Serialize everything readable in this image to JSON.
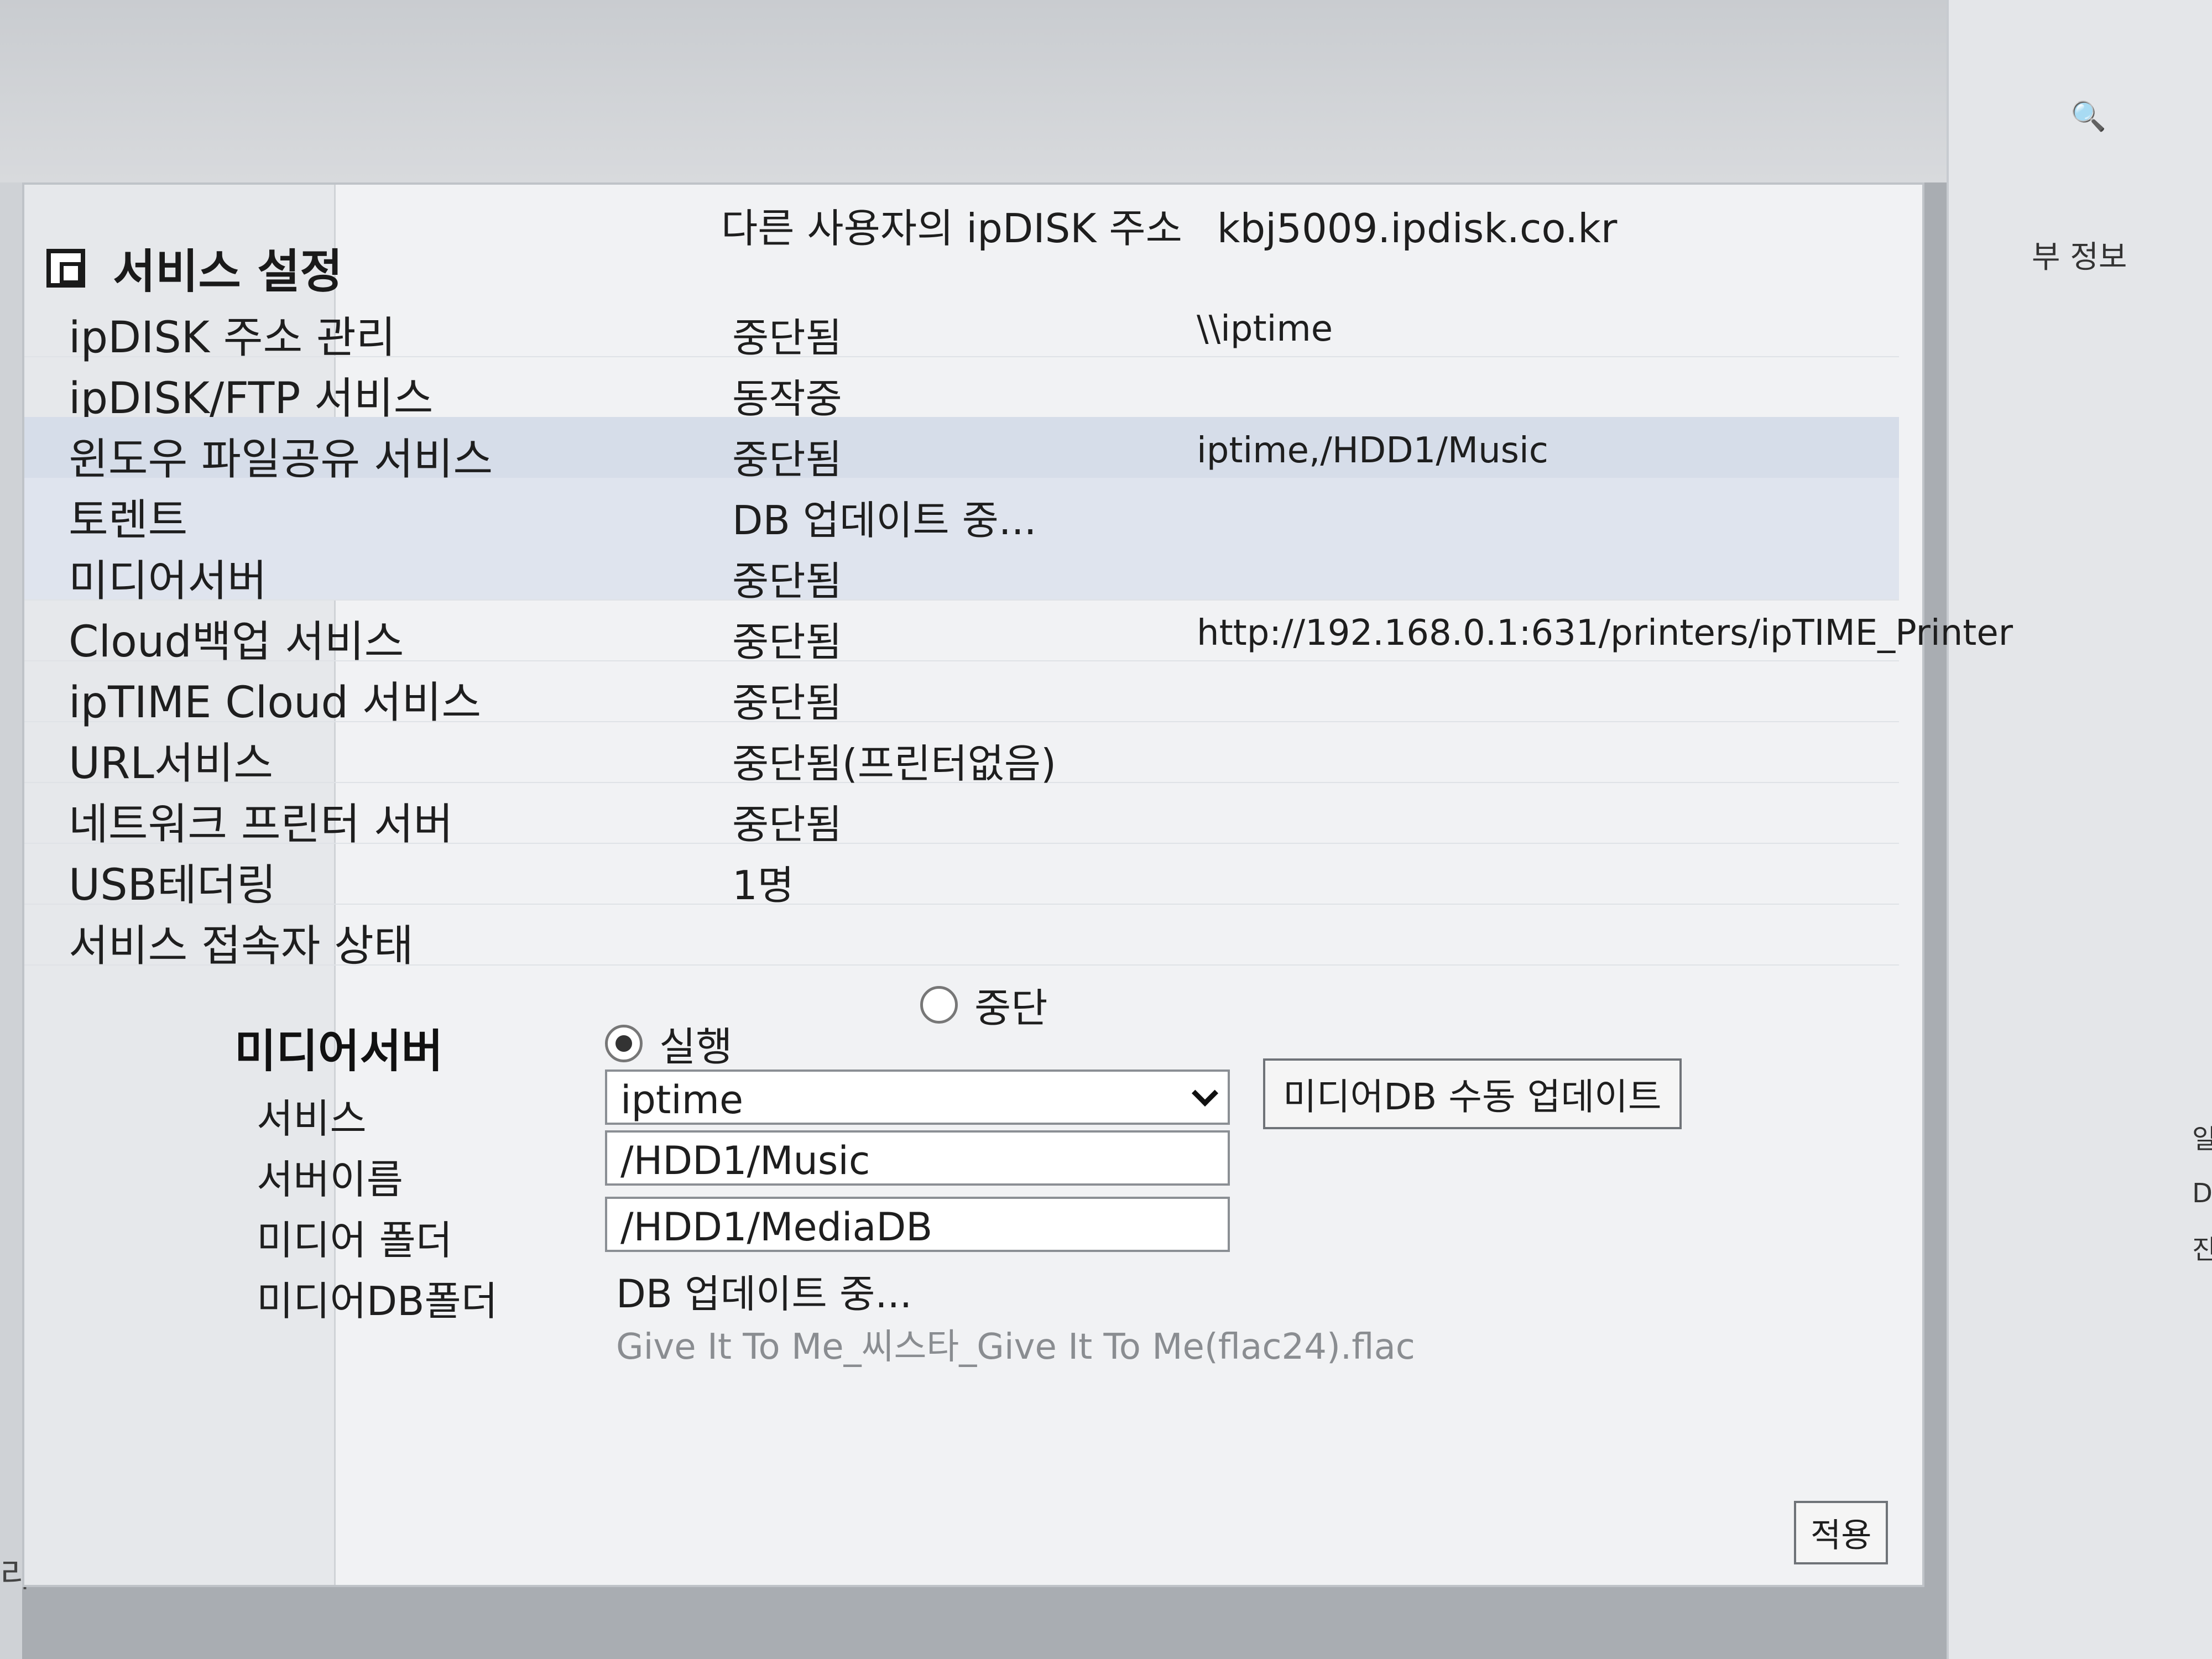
{
  "header": {
    "title": "서비스 설정",
    "address_label": "다른 사용자의 ipDISK 주소",
    "address_value": "kbj5009.ipdisk.co.kr"
  },
  "background": {
    "side_label": "부 정보",
    "left_edge_text": "리",
    "right_fragments": [
      "일 크",
      "Dat",
      "진"
    ]
  },
  "services": [
    {
      "name": "ipDISK 주소 관리",
      "status": "중단됨",
      "detail": "\\\\iptime"
    },
    {
      "name": "ipDISK/FTP 서비스",
      "status": "동작중",
      "detail": ""
    },
    {
      "name": "윈도우 파일공유 서비스",
      "status": "중단됨",
      "detail": "iptime,/HDD1/Music"
    },
    {
      "name": "토렌트",
      "status": "DB 업데이트 중...",
      "detail": ""
    },
    {
      "name": "미디어서버",
      "status": "중단됨",
      "detail": ""
    },
    {
      "name": "Cloud백업 서비스",
      "status": "중단됨",
      "detail": "http://192.168.0.1:631/printers/ipTIME_Printer"
    },
    {
      "name": "ipTIME Cloud 서비스",
      "status": "중단됨",
      "detail": ""
    },
    {
      "name": "URL서비스",
      "status": "중단됨(프린터없음)",
      "detail": ""
    },
    {
      "name": "네트워크 프린터 서버",
      "status": "중단됨",
      "detail": ""
    },
    {
      "name": "USB테더링",
      "status": "1명",
      "detail": ""
    },
    {
      "name": "서비스 접속자 상태",
      "status": "",
      "detail": ""
    }
  ],
  "media_server": {
    "section_title": "미디어서버",
    "labels": {
      "service": "서비스",
      "server_name": "서버이름",
      "media_folder": "미디어 폴더",
      "mediadb_folder": "미디어DB폴더"
    },
    "radio_run": "실행",
    "radio_stop": "중단",
    "server_name_value": "iptime",
    "media_folder_value": "/HDD1/Music",
    "mediadb_folder_value": "/HDD1/MediaDB",
    "db_status": "DB 업데이트 중...",
    "current_file": "Give It To Me_씨스타_Give It To Me(flac24).flac",
    "manual_update_button": "미디어DB 수동 업데이트",
    "apply_button": "적용"
  }
}
